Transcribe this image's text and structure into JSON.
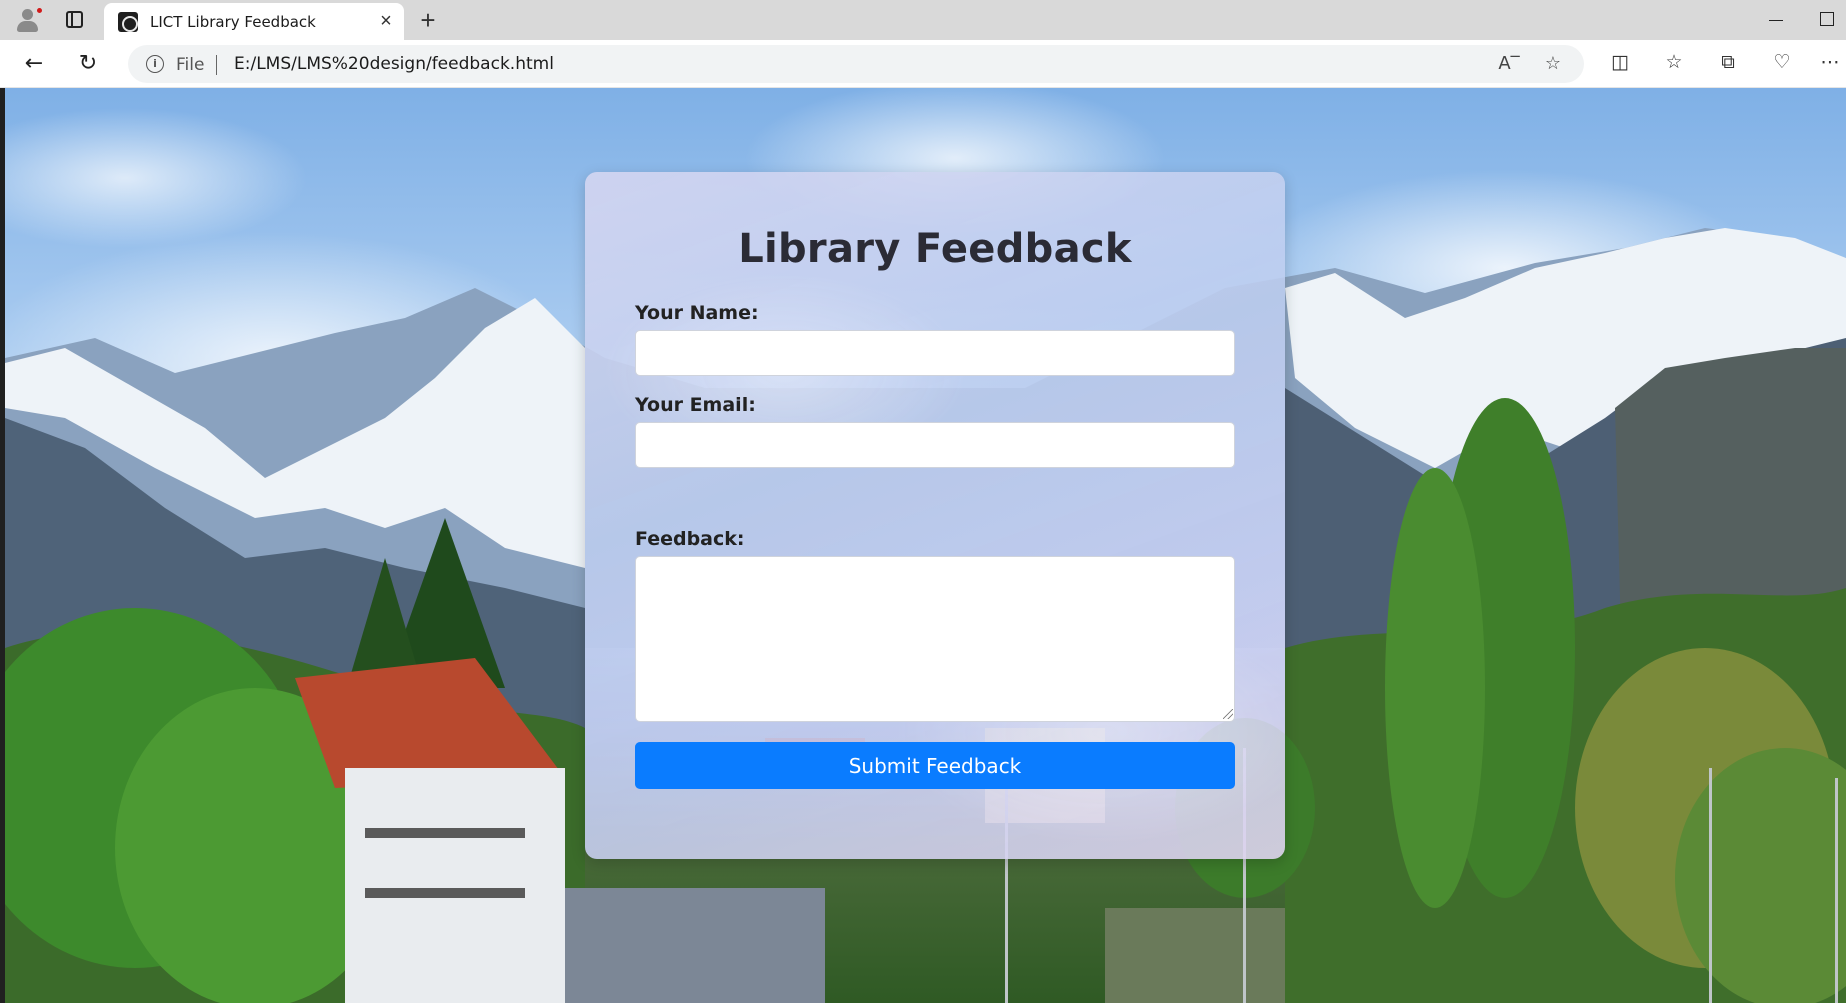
{
  "browser": {
    "tab": {
      "title": "LICT Library Feedback",
      "close_glyph": "×",
      "favicon": "library-logo-icon"
    },
    "new_tab_glyph": "+",
    "address": {
      "scheme_label": "File",
      "url": "E:/LMS/LMS%20design/feedback.html"
    },
    "icons": {
      "back": "back-arrow-icon",
      "refresh": "refresh-icon",
      "read_aloud": "read-aloud-icon",
      "favorite": "star-icon",
      "split_screen": "split-screen-icon",
      "favorites": "favorites-icon",
      "collections": "collections-icon",
      "browser_essentials": "heart-pulse-icon",
      "more": "more-icon"
    }
  },
  "form": {
    "title": "Library Feedback",
    "name_label": "Your Name:",
    "name_value": "",
    "email_label": "Your Email:",
    "email_value": "",
    "feedback_label": "Feedback:",
    "feedback_value": "",
    "submit_label": "Submit Feedback"
  },
  "colors": {
    "submit_button": "#0a7cff",
    "title_text": "#2b2b35",
    "card_tint": "#c6d2f2"
  }
}
